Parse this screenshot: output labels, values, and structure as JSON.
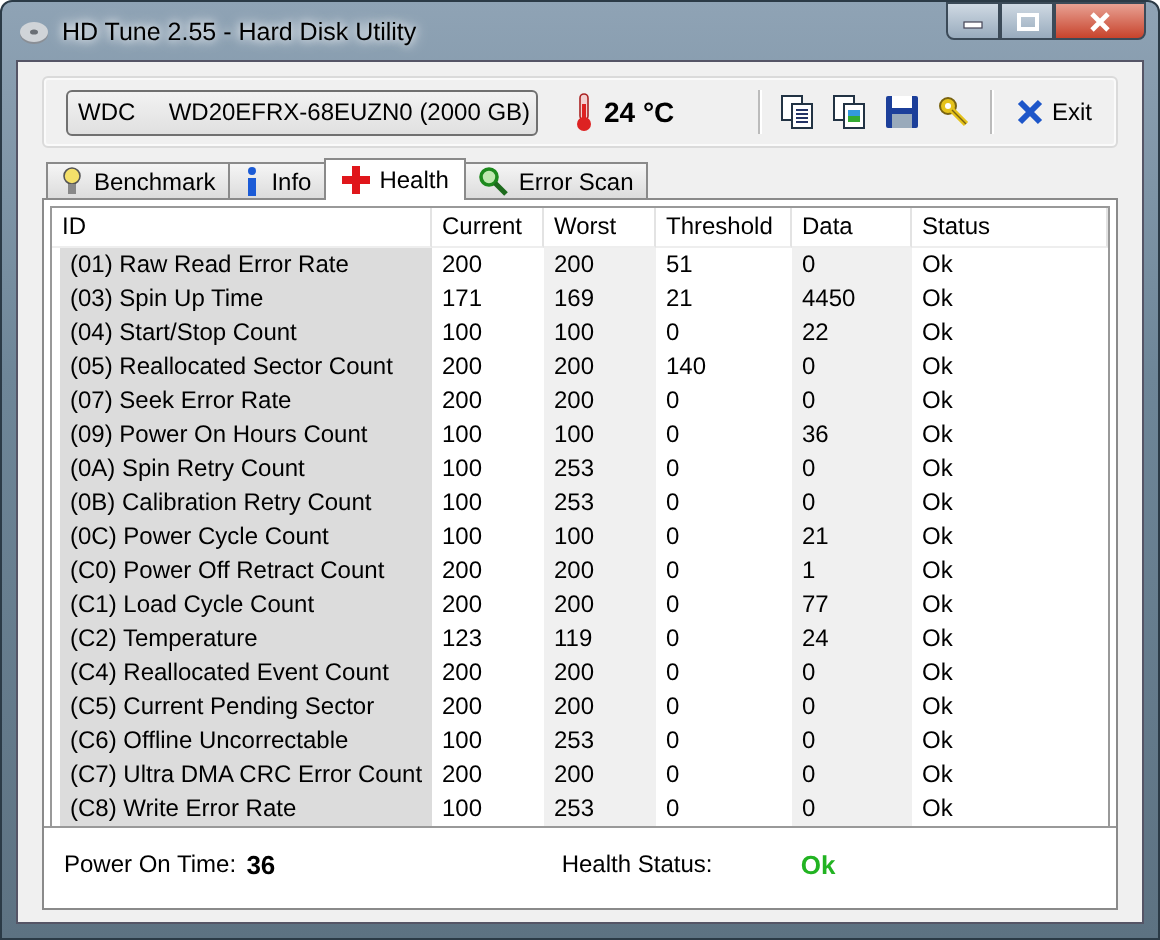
{
  "window": {
    "title": "HD Tune 2.55 - Hard Disk Utility"
  },
  "toolbar": {
    "drive": "WDC     WD20EFRX-68EUZN0 (2000 GB)",
    "temperature": "24 °C",
    "exit": "Exit"
  },
  "tabs": [
    {
      "label": "Benchmark",
      "kind": "benchmark",
      "selected": false
    },
    {
      "label": "Info",
      "kind": "info",
      "selected": false
    },
    {
      "label": "Health",
      "kind": "health",
      "selected": true
    },
    {
      "label": "Error Scan",
      "kind": "scan",
      "selected": false
    }
  ],
  "table": {
    "columns": [
      "ID",
      "Current",
      "Worst",
      "Threshold",
      "Data",
      "Status"
    ],
    "rows": [
      [
        "(01) Raw Read Error Rate",
        "200",
        "200",
        "51",
        "0",
        "Ok"
      ],
      [
        "(03) Spin Up Time",
        "171",
        "169",
        "21",
        "4450",
        "Ok"
      ],
      [
        "(04) Start/Stop Count",
        "100",
        "100",
        "0",
        "22",
        "Ok"
      ],
      [
        "(05) Reallocated Sector Count",
        "200",
        "200",
        "140",
        "0",
        "Ok"
      ],
      [
        "(07) Seek Error Rate",
        "200",
        "200",
        "0",
        "0",
        "Ok"
      ],
      [
        "(09) Power On Hours Count",
        "100",
        "100",
        "0",
        "36",
        "Ok"
      ],
      [
        "(0A) Spin Retry Count",
        "100",
        "253",
        "0",
        "0",
        "Ok"
      ],
      [
        "(0B) Calibration Retry Count",
        "100",
        "253",
        "0",
        "0",
        "Ok"
      ],
      [
        "(0C) Power Cycle Count",
        "100",
        "100",
        "0",
        "21",
        "Ok"
      ],
      [
        "(C0) Power Off Retract Count",
        "200",
        "200",
        "0",
        "1",
        "Ok"
      ],
      [
        "(C1) Load Cycle Count",
        "200",
        "200",
        "0",
        "77",
        "Ok"
      ],
      [
        "(C2) Temperature",
        "123",
        "119",
        "0",
        "24",
        "Ok"
      ],
      [
        "(C4) Reallocated Event Count",
        "200",
        "200",
        "0",
        "0",
        "Ok"
      ],
      [
        "(C5) Current Pending Sector",
        "200",
        "200",
        "0",
        "0",
        "Ok"
      ],
      [
        "(C6) Offline Uncorrectable",
        "100",
        "253",
        "0",
        "0",
        "Ok"
      ],
      [
        "(C7) Ultra DMA CRC Error Count",
        "200",
        "200",
        "0",
        "0",
        "Ok"
      ],
      [
        "(C8) Write Error Rate",
        "100",
        "253",
        "0",
        "0",
        "Ok"
      ]
    ]
  },
  "footer": {
    "power_on_label": "Power On Time:",
    "power_on_value": "36",
    "health_label": "Health Status:",
    "health_value": "Ok"
  }
}
